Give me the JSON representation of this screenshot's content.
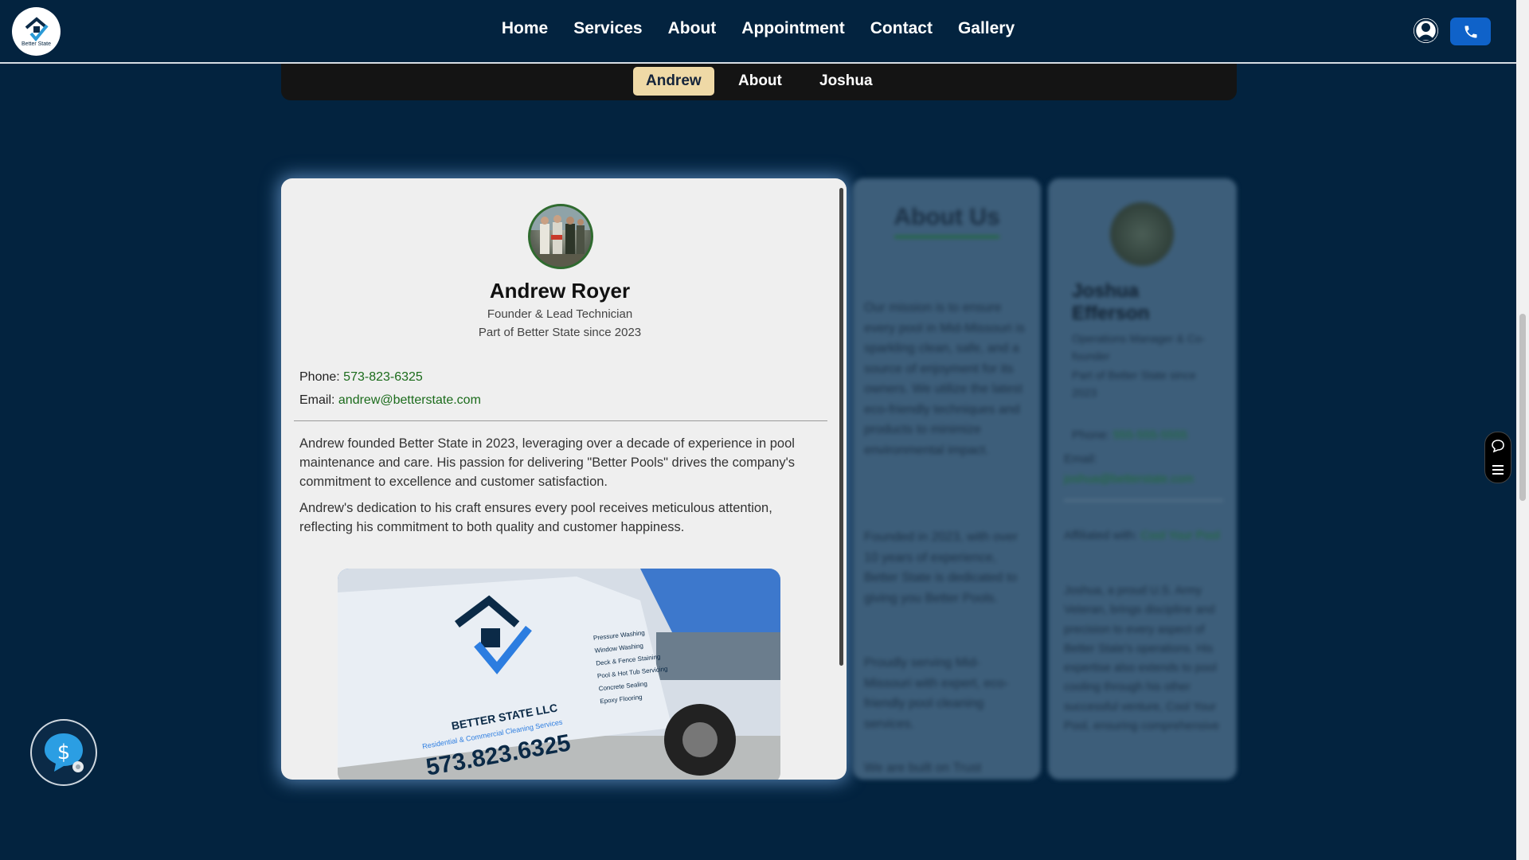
{
  "nav": {
    "logo_text": "Better State",
    "links": [
      "Home",
      "Services",
      "About",
      "Appointment",
      "Contact",
      "Gallery"
    ]
  },
  "tabs": [
    "Andrew",
    "About",
    "Joshua"
  ],
  "active_tab": "Andrew",
  "profile": {
    "name": "Andrew Royer",
    "title": "Founder & Lead Technician",
    "since": "Part of Better State since 2023",
    "phone_label": "Phone:",
    "phone": "573-823-6325",
    "email_label": "Email:",
    "email": "andrew@betterstate.com",
    "bio": [
      "Andrew founded Better State in 2023, leveraging over a decade of experience in pool maintenance and care. His passion for delivering \"Better Pools\" drives the company's commitment to excellence and customer satisfaction.",
      "Andrew's dedication to his craft ensures every pool receives meticulous attention, reflecting his commitment to both quality and customer happiness."
    ],
    "truck": {
      "company": "BETTER STATE LLC",
      "tagline": "Residential & Commercial Cleaning Services",
      "phone": "573.823.6325",
      "services": [
        "Pressure Washing",
        "Window Washing",
        "Deck & Fence Staining",
        "Pool & Hot Tub Servicing",
        "Concrete Sealing",
        "Epoxy Flooring"
      ]
    }
  },
  "about_card": {
    "heading": "About Us",
    "paragraphs": [
      "Our mission is to ensure every pool in Mid-Missouri is sparkling clean, safe, and a source of enjoyment for its owners. We utilize the latest eco-friendly techniques and products to minimize environmental impact.",
      "Founded in 2023, with over 10 years of experience, Better State is dedicated to giving you Better Pools.",
      "Proudly serving Mid-Missouri with expert, eco-friendly pool cleaning services.",
      "We are built on Trust"
    ]
  },
  "joshua_card": {
    "name": "Joshua Efferson",
    "title": "Operations Manager & Co-founder",
    "since": "Part of Better State since 2023",
    "phone_label": "Phone:",
    "phone": "555-555-5555",
    "email_label": "Email:",
    "email": "joshua@betterstate.com",
    "affiliated_label": "Affiliated with:",
    "affiliated": "Cool Your Pool",
    "bio": "Joshua, a proud U.S. Army Veteran, brings discipline and precision to every aspect of Better State's operations. His expertise also extends to pool cooling through his other successful venture, Cool Your Pool, ensuring comprehensive"
  },
  "colors": {
    "background": "#03233f",
    "accent_tab": "#efd9a6",
    "link_green": "#1b6b1b",
    "phone_button": "#0f62c9"
  },
  "icons": [
    "logo-icon",
    "user-icon",
    "phone-icon",
    "chat-icon",
    "menu-icon",
    "dollar-chat-icon"
  ]
}
